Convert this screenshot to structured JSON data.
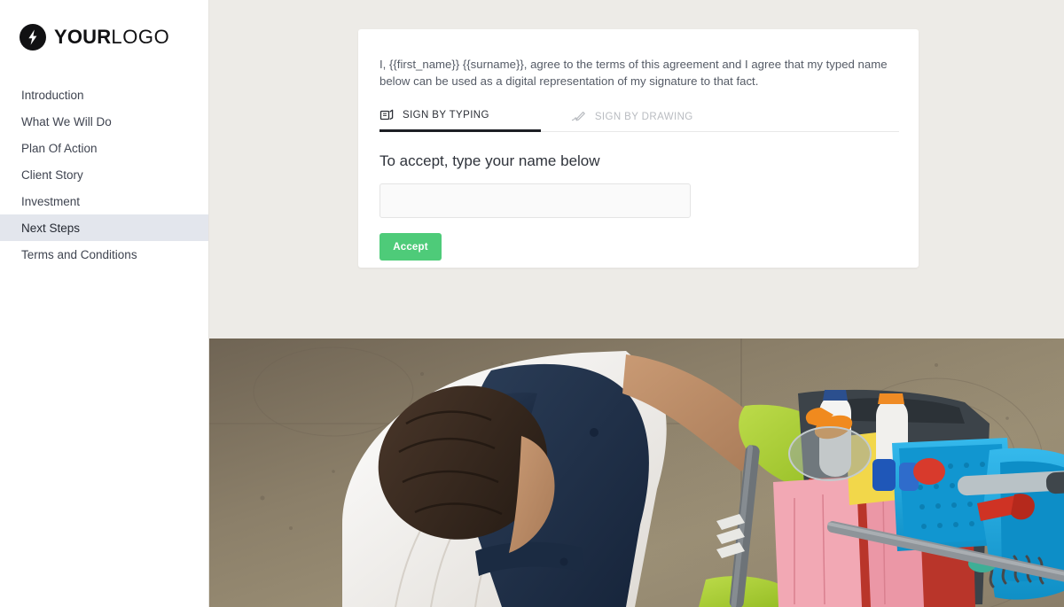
{
  "sidebar": {
    "logo": {
      "icon": "lightning-bolt-icon",
      "bold_text": "YOUR",
      "light_text": "LOGO"
    },
    "items": [
      {
        "label": "Introduction",
        "active": false
      },
      {
        "label": "What We Will Do",
        "active": false
      },
      {
        "label": "Plan Of Action",
        "active": false
      },
      {
        "label": "Client Story",
        "active": false
      },
      {
        "label": "Investment",
        "active": false
      },
      {
        "label": "Next Steps",
        "active": true
      },
      {
        "label": "Terms and Conditions",
        "active": false
      }
    ],
    "active_item": "Next Steps",
    "background_color": "#ffffff",
    "active_background_color": "#e3e6ed"
  },
  "card": {
    "agreement_text": "I, {{first_name}} {{surname}}, agree to the terms of this agreement and I agree that my typed name below can be used as a digital representation of my signature to that fact.",
    "tabs": [
      {
        "label": "SIGN BY TYPING",
        "icon": "keyboard-icon",
        "active": true
      },
      {
        "label": "SIGN BY DRAWING",
        "icon": "pen-signature-icon",
        "active": false
      }
    ],
    "accept_heading": "To accept, type your name below",
    "name_input": {
      "value": "",
      "placeholder": ""
    },
    "accept_button": {
      "label": "Accept",
      "color": "#4ecb79"
    }
  },
  "photo": {
    "alt": "Overhead view of a cleaner in white shirt and navy apron with green rubber gloves pushing a blue mop bucket cleaning cart on a brown concrete floor",
    "colors": {
      "floor": "#867a66",
      "shirt": "#f2f1ee",
      "apron": "#23344c",
      "glove": "#a9d036",
      "hair": "#3a2a20",
      "cart_blue": "#1ba7e0",
      "cart_red": "#c0382c",
      "cloth_pink": "#f2a8b4",
      "cloth_yellow": "#f2d74a"
    }
  },
  "page": {
    "background_color": "#edebe7"
  }
}
